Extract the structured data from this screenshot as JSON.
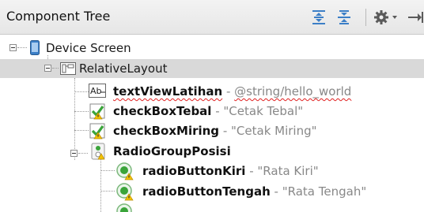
{
  "header": {
    "title": "Component Tree"
  },
  "tree": {
    "device_screen": {
      "label": "Device Screen"
    },
    "relative_layout": {
      "label": "RelativeLayout"
    },
    "textview": {
      "name": "textViewLatihan",
      "sep": " - ",
      "value": "@string/hello_world"
    },
    "checkbox_tebal": {
      "name": "checkBoxTebal",
      "sep": " - ",
      "value": "\"Cetak Tebal\""
    },
    "checkbox_miring": {
      "name": "checkBoxMiring",
      "sep": " - ",
      "value": "\"Cetak Miring\""
    },
    "radio_group": {
      "name": "RadioGroupPosisi"
    },
    "radio_kiri": {
      "name": "radioButtonKiri",
      "sep": " - ",
      "value": "\"Rata Kiri\""
    },
    "radio_tengah": {
      "name": "radioButtonTengah",
      "sep": " - ",
      "value": "\"Rata Tengah\""
    }
  },
  "icons": {
    "expand_all": "expand-all-icon",
    "collapse_all": "collapse-all-icon",
    "settings": "gear-icon",
    "hide": "hide-panel-icon"
  },
  "colors": {
    "accent_blue": "#3c7fc7",
    "check_green": "#3aa43a",
    "warning_yellow": "#f2c200",
    "error_red": "#e02020"
  }
}
